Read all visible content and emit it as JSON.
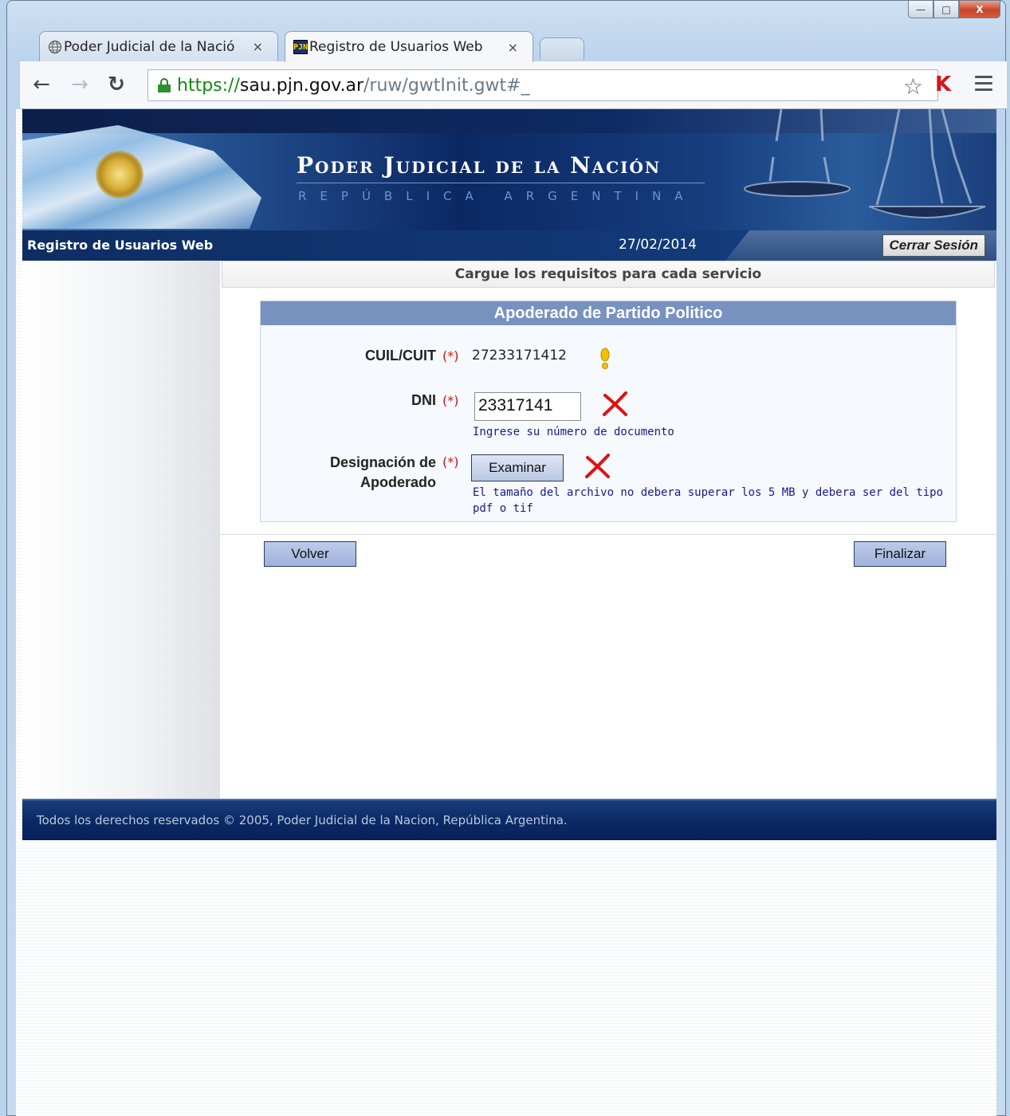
{
  "window": {
    "minimize_label": "—",
    "maximize_label": "□",
    "close_label": "X"
  },
  "tabs": [
    {
      "title": "Poder Judicial de la Nació",
      "close": "×"
    },
    {
      "title": "Registro de Usuarios Web",
      "close": "×"
    }
  ],
  "toolbar": {
    "url_scheme": "https://",
    "url_host": "sau.pjn.gov.ar",
    "url_path": "/ruw/gwtInit.gwt#_"
  },
  "banner": {
    "title": "Poder Judicial de la Nación",
    "subtitle": "REPÚBLICA ARGENTINA"
  },
  "statusbar": {
    "app_name": "Registro de Usuarios Web",
    "date": "27/02/2014",
    "logout_label": "Cerrar Sesión"
  },
  "section": {
    "header": "Cargue los requisitos para cada servicio"
  },
  "form": {
    "title": "Apoderado de Partido Politico",
    "required_marker": "(*)",
    "cuil_label": "CUIL/CUIT",
    "cuil_value": "27233171412",
    "dni_label": "DNI",
    "dni_value": "23317141",
    "dni_hint": "Ingrese su número de documento",
    "designacion_label_line1": "Designación de",
    "designacion_label_line2": "Apoderado",
    "browse_label": "Examinar",
    "file_hint_line1": "El tamaño del archivo no debera superar los 5 MB y debera ser del tipo",
    "file_hint_line2": "pdf o tif"
  },
  "actions": {
    "back_label": "Volver",
    "finish_label": "Finalizar"
  },
  "footer": {
    "text": "Todos los derechos reservados © 2005,  Poder Judicial de la Nacion,  República Argentina."
  },
  "colors": {
    "header_blue": "#0e2d63",
    "form_title_bg": "#7792bf",
    "required_red": "#d01010",
    "hint_blue": "#1a1a8a"
  }
}
